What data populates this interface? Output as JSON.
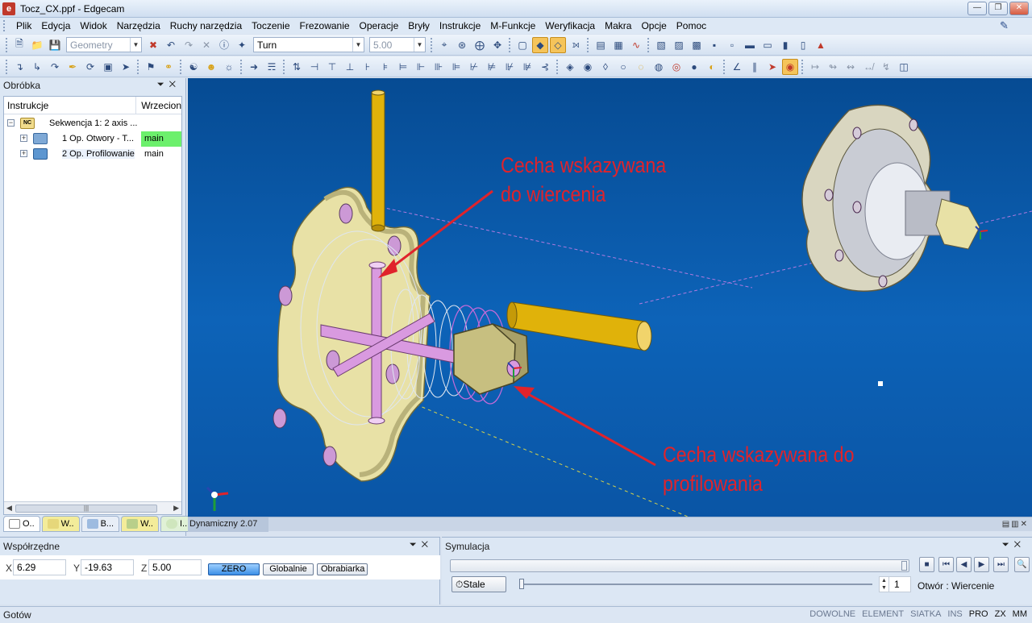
{
  "window": {
    "title": "Tocz_CX.ppf - Edgecam",
    "app_icon": "e",
    "buttons": [
      "minimize",
      "restore",
      "close"
    ]
  },
  "menu": {
    "items": [
      "Plik",
      "Edycja",
      "Widok",
      "Narzędzia",
      "Ruchy narzędzia",
      "Toczenie",
      "Frezowanie",
      "Operacje",
      "Bryły",
      "Instrukcje",
      "M-Funkcje",
      "Weryfikacja",
      "Makra",
      "Opcje",
      "Pomoc"
    ]
  },
  "toolbar": {
    "geometry_combo": "Geometry",
    "turn_combo": "Turn",
    "value_combo": "5.00"
  },
  "left_panel": {
    "title": "Obróbka",
    "col_instrukcje": "Instrukcje",
    "col_wrzeciono": "Wrzecion",
    "rows": [
      {
        "label": "Sekwencja 1: 2 axis ...",
        "spindle": ""
      },
      {
        "label": "1 Op. Otwory - T...",
        "spindle": "main"
      },
      {
        "label": "2 Op. Profilowanie",
        "spindle": "main"
      }
    ],
    "tabs": [
      "O..",
      "W..",
      "B...",
      "W..",
      "I..."
    ]
  },
  "viewport": {
    "annotation_top": [
      "Cecha wskazywana",
      "do wiercenia"
    ],
    "annotation_bottom": [
      "Cecha wskazywana do",
      "profilowania"
    ],
    "status": "Dynamiczny 2.07"
  },
  "coords": {
    "title": "Współrzędne",
    "x_label": "X",
    "x_value": "6.29",
    "y_label": "Y",
    "y_value": "-19.63",
    "z_label": "Z",
    "z_value": "5.00",
    "btn_zero": "ZERO",
    "btn_global": "Globalnie",
    "btn_machine": "Obrabiarka"
  },
  "simulation": {
    "title": "Symulacja",
    "stale_btn": "Stale",
    "spinner_value": "1",
    "operation": "Otwór : Wiercenie"
  },
  "statusbar": {
    "text": "Gotów",
    "flags": [
      {
        "label": "DOWOLNE",
        "on": false
      },
      {
        "label": "ELEMENT",
        "on": false
      },
      {
        "label": "SIATKA",
        "on": false
      },
      {
        "label": "INS",
        "on": false
      },
      {
        "label": "PRO",
        "on": true
      },
      {
        "label": "ZX",
        "on": true
      },
      {
        "label": "MM",
        "on": true
      }
    ]
  },
  "colors": {
    "viewport_bg": "#0a5aa8",
    "annotation": "#e0232b",
    "highlight_cell": "#6cf06c",
    "tool_yellow": "#e0b20a",
    "part_cream": "#e8e1a6",
    "feature_pink": "#d99ae0"
  }
}
